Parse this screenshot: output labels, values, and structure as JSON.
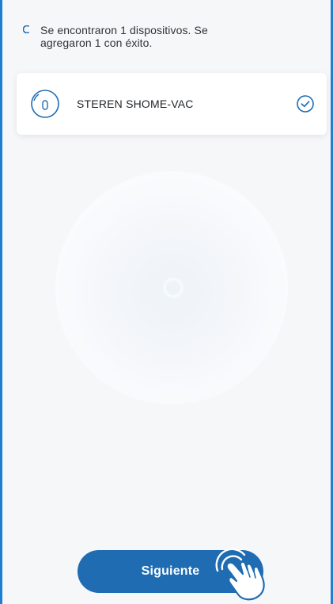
{
  "status": {
    "line1": "Se encontraron 1 dispositivos. Se",
    "line2": "agregaron 1 con éxito."
  },
  "device": {
    "name": "STEREN SHOME-VAC",
    "icon": "robot-vacuum-icon",
    "state_icon": "check-circle-icon"
  },
  "button": {
    "label": "Siguiente"
  },
  "colors": {
    "accent": "#1f6cb3",
    "frame": "#1f7fd0"
  }
}
